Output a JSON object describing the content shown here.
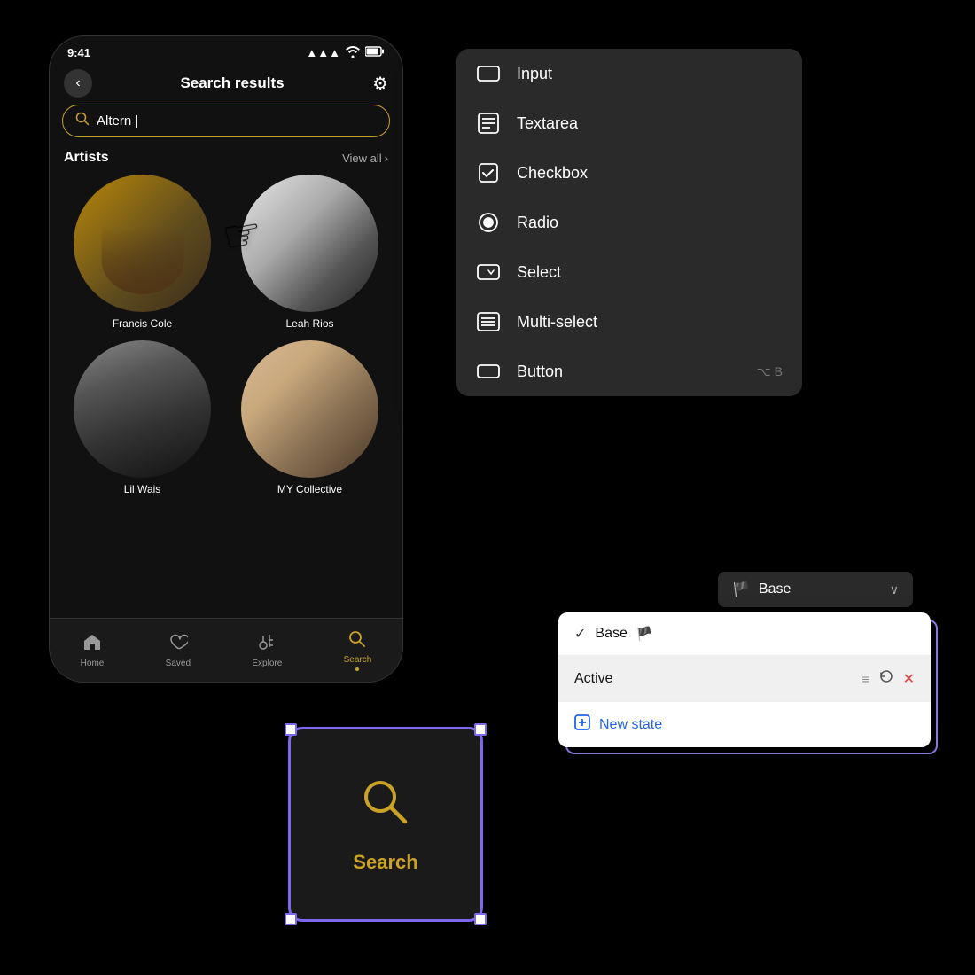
{
  "phone": {
    "statusbar": {
      "time": "9:41",
      "signal": "▲▲▲",
      "wifi": "wifi",
      "battery": "battery"
    },
    "header": {
      "back": "‹",
      "title": "Search results",
      "settings": "⚙"
    },
    "searchbar": {
      "value": "Altern |"
    },
    "artists": {
      "label": "Artists",
      "viewall": "View all"
    },
    "artist_list": [
      {
        "name": "Francis Cole"
      },
      {
        "name": "Leah Rios"
      },
      {
        "name": "Lil Wais"
      },
      {
        "name": "MY Collective"
      }
    ],
    "navbar": [
      {
        "label": "Home",
        "icon": "⌂",
        "active": false
      },
      {
        "label": "Saved",
        "icon": "♡",
        "active": false
      },
      {
        "label": "Explore",
        "icon": "♩",
        "active": false
      },
      {
        "label": "Search",
        "icon": "⌕",
        "active": true
      }
    ]
  },
  "dropdown_menu": {
    "items": [
      {
        "label": "Input",
        "shortcut": ""
      },
      {
        "label": "Textarea",
        "shortcut": ""
      },
      {
        "label": "Checkbox",
        "shortcut": ""
      },
      {
        "label": "Radio",
        "shortcut": ""
      },
      {
        "label": "Select",
        "shortcut": ""
      },
      {
        "label": "Multi-select",
        "shortcut": ""
      },
      {
        "label": "Button",
        "shortcut": "⌥ B"
      }
    ]
  },
  "search_component": {
    "icon": "🔍",
    "label": "Search"
  },
  "state_panel": {
    "header": {
      "icon": "🏴",
      "label": "Base",
      "chevron": "∨"
    },
    "states": [
      {
        "name": "Base",
        "checked": true,
        "flag": true
      },
      {
        "name": "Active",
        "checked": false,
        "flag": false
      },
      {
        "name": "New state",
        "is_new": true
      }
    ]
  },
  "colors": {
    "accent_yellow": "#C9A227",
    "accent_green": "#00C896",
    "accent_purple": "#7B68EE",
    "accent_blue": "#2563EB"
  }
}
